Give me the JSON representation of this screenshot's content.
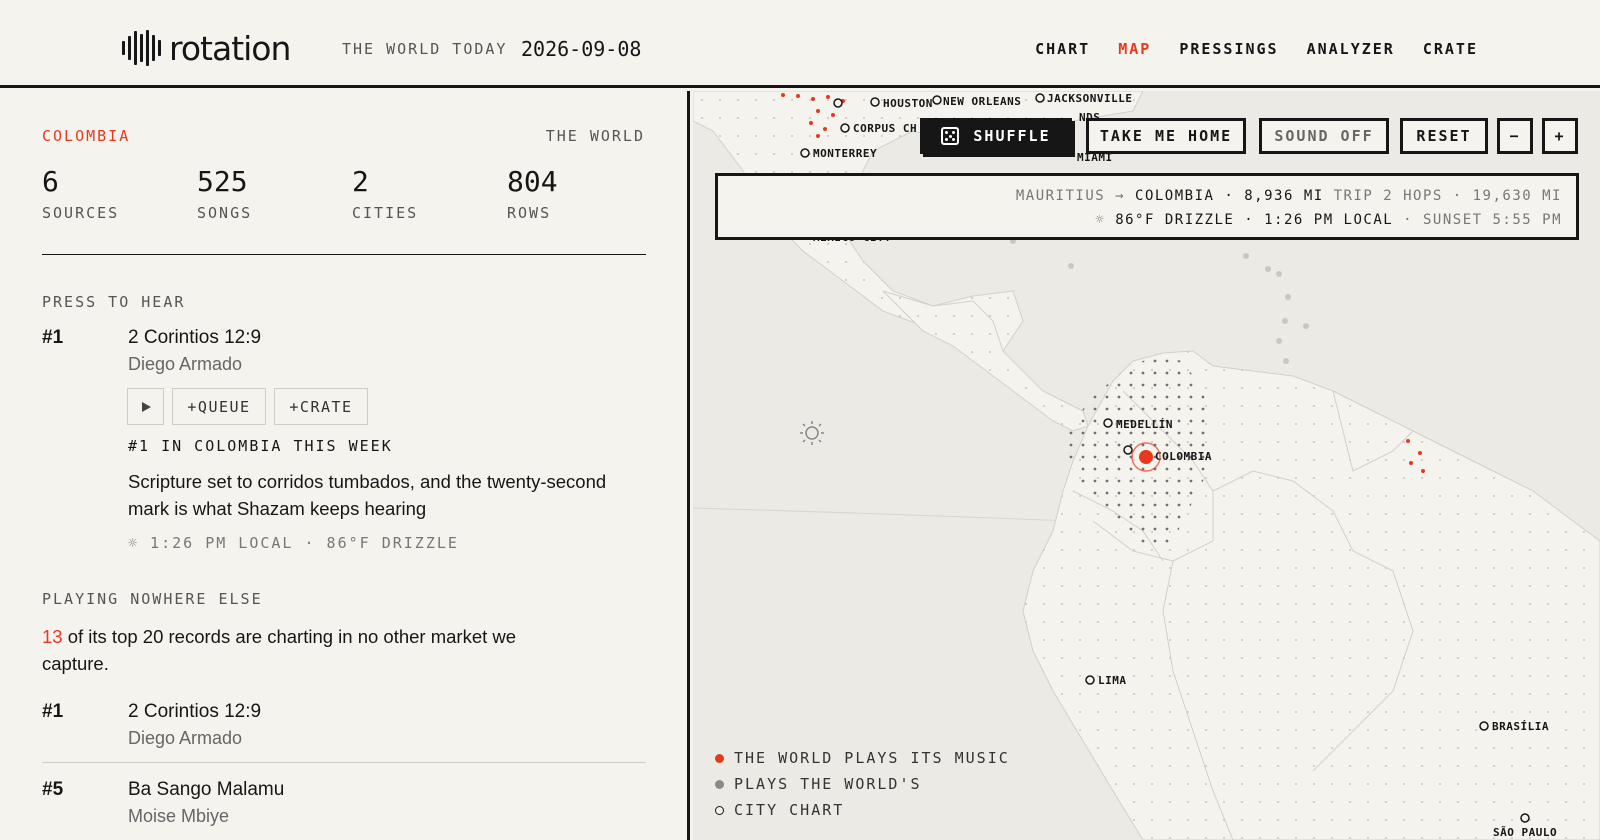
{
  "header": {
    "brand": "rotation",
    "tagline": "THE WORLD TODAY",
    "date": "2026-09-08",
    "nav": [
      {
        "label": "CHART",
        "active": false
      },
      {
        "label": "MAP",
        "active": true
      },
      {
        "label": "PRESSINGS",
        "active": false
      },
      {
        "label": "ANALYZER",
        "active": false
      },
      {
        "label": "CRATE",
        "active": false
      }
    ]
  },
  "panel": {
    "country": "COLOMBIA",
    "scope_link": "THE WORLD",
    "stats": [
      {
        "value": "6",
        "label": "SOURCES"
      },
      {
        "value": "525",
        "label": "SONGS"
      },
      {
        "value": "2",
        "label": "CITIES"
      },
      {
        "value": "804",
        "label": "ROWS"
      }
    ],
    "press_to_hear": {
      "section_title": "PRESS TO HEAR",
      "rank": "#1",
      "title": "2 Corintios 12:9",
      "artist": "Diego Armado",
      "play_icon": "play-icon",
      "queue_label": "+QUEUE",
      "crate_label": "+CRATE",
      "chart_note": "#1 IN COLOMBIA THIS WEEK",
      "description": "Scripture set to corridos tumbados, and the twenty-second mark is what Shazam keeps hearing",
      "local_info": "☼ 1:26 PM LOCAL · 86°F DRIZZLE"
    },
    "playing_nowhere_else": {
      "section_title": "PLAYING NOWHERE ELSE",
      "count": "13",
      "text": " of its top 20 records are charting in no other market we capture.",
      "tracks": [
        {
          "rank": "#1",
          "title": "2 Corintios 12:9",
          "artist": "Diego Armado"
        },
        {
          "rank": "#5",
          "title": "Ba Sango Malamu",
          "artist": "Moise Mbiye"
        }
      ]
    }
  },
  "map": {
    "controls": {
      "shuffle": "SHUFFLE",
      "take_me_home": "TAKE ME HOME",
      "sound": "SOUND OFF",
      "reset": "RESET",
      "zoom_out": "−",
      "zoom_in": "+"
    },
    "info": {
      "from": "MAURITIUS",
      "arrow": "→",
      "to": "COLOMBIA",
      "distance": "· 8,936 MI",
      "trip": "TRIP 2 HOPS · 19,630 MI",
      "weather_icon": "☼",
      "weather": "86°F DRIZZLE · 1:26 PM LOCAL",
      "sunset": "· SUNSET 5:55 PM"
    },
    "cities": [
      "HOUSTON",
      "NEW ORLEANS",
      "JACKSONVILLE",
      "CORPUS CH",
      "MONTERREY",
      "MIAMI",
      "MEXICO CITY",
      "MEDELLÍN",
      "COLOMBIA",
      "LIMA",
      "BRASÍLIA",
      "SÃO PAULO",
      "NDS"
    ],
    "legend": [
      {
        "label": "THE WORLD PLAYS ITS MUSIC",
        "color": "#e8391f"
      },
      {
        "label": "PLAYS THE WORLD'S",
        "color": "#8a8a8a"
      },
      {
        "label": "CITY CHART",
        "color": "outline"
      }
    ],
    "colors": {
      "accent": "#e8391f",
      "ink": "#161616",
      "land": "#f4f3ee",
      "sea": "#ebeae5"
    }
  }
}
